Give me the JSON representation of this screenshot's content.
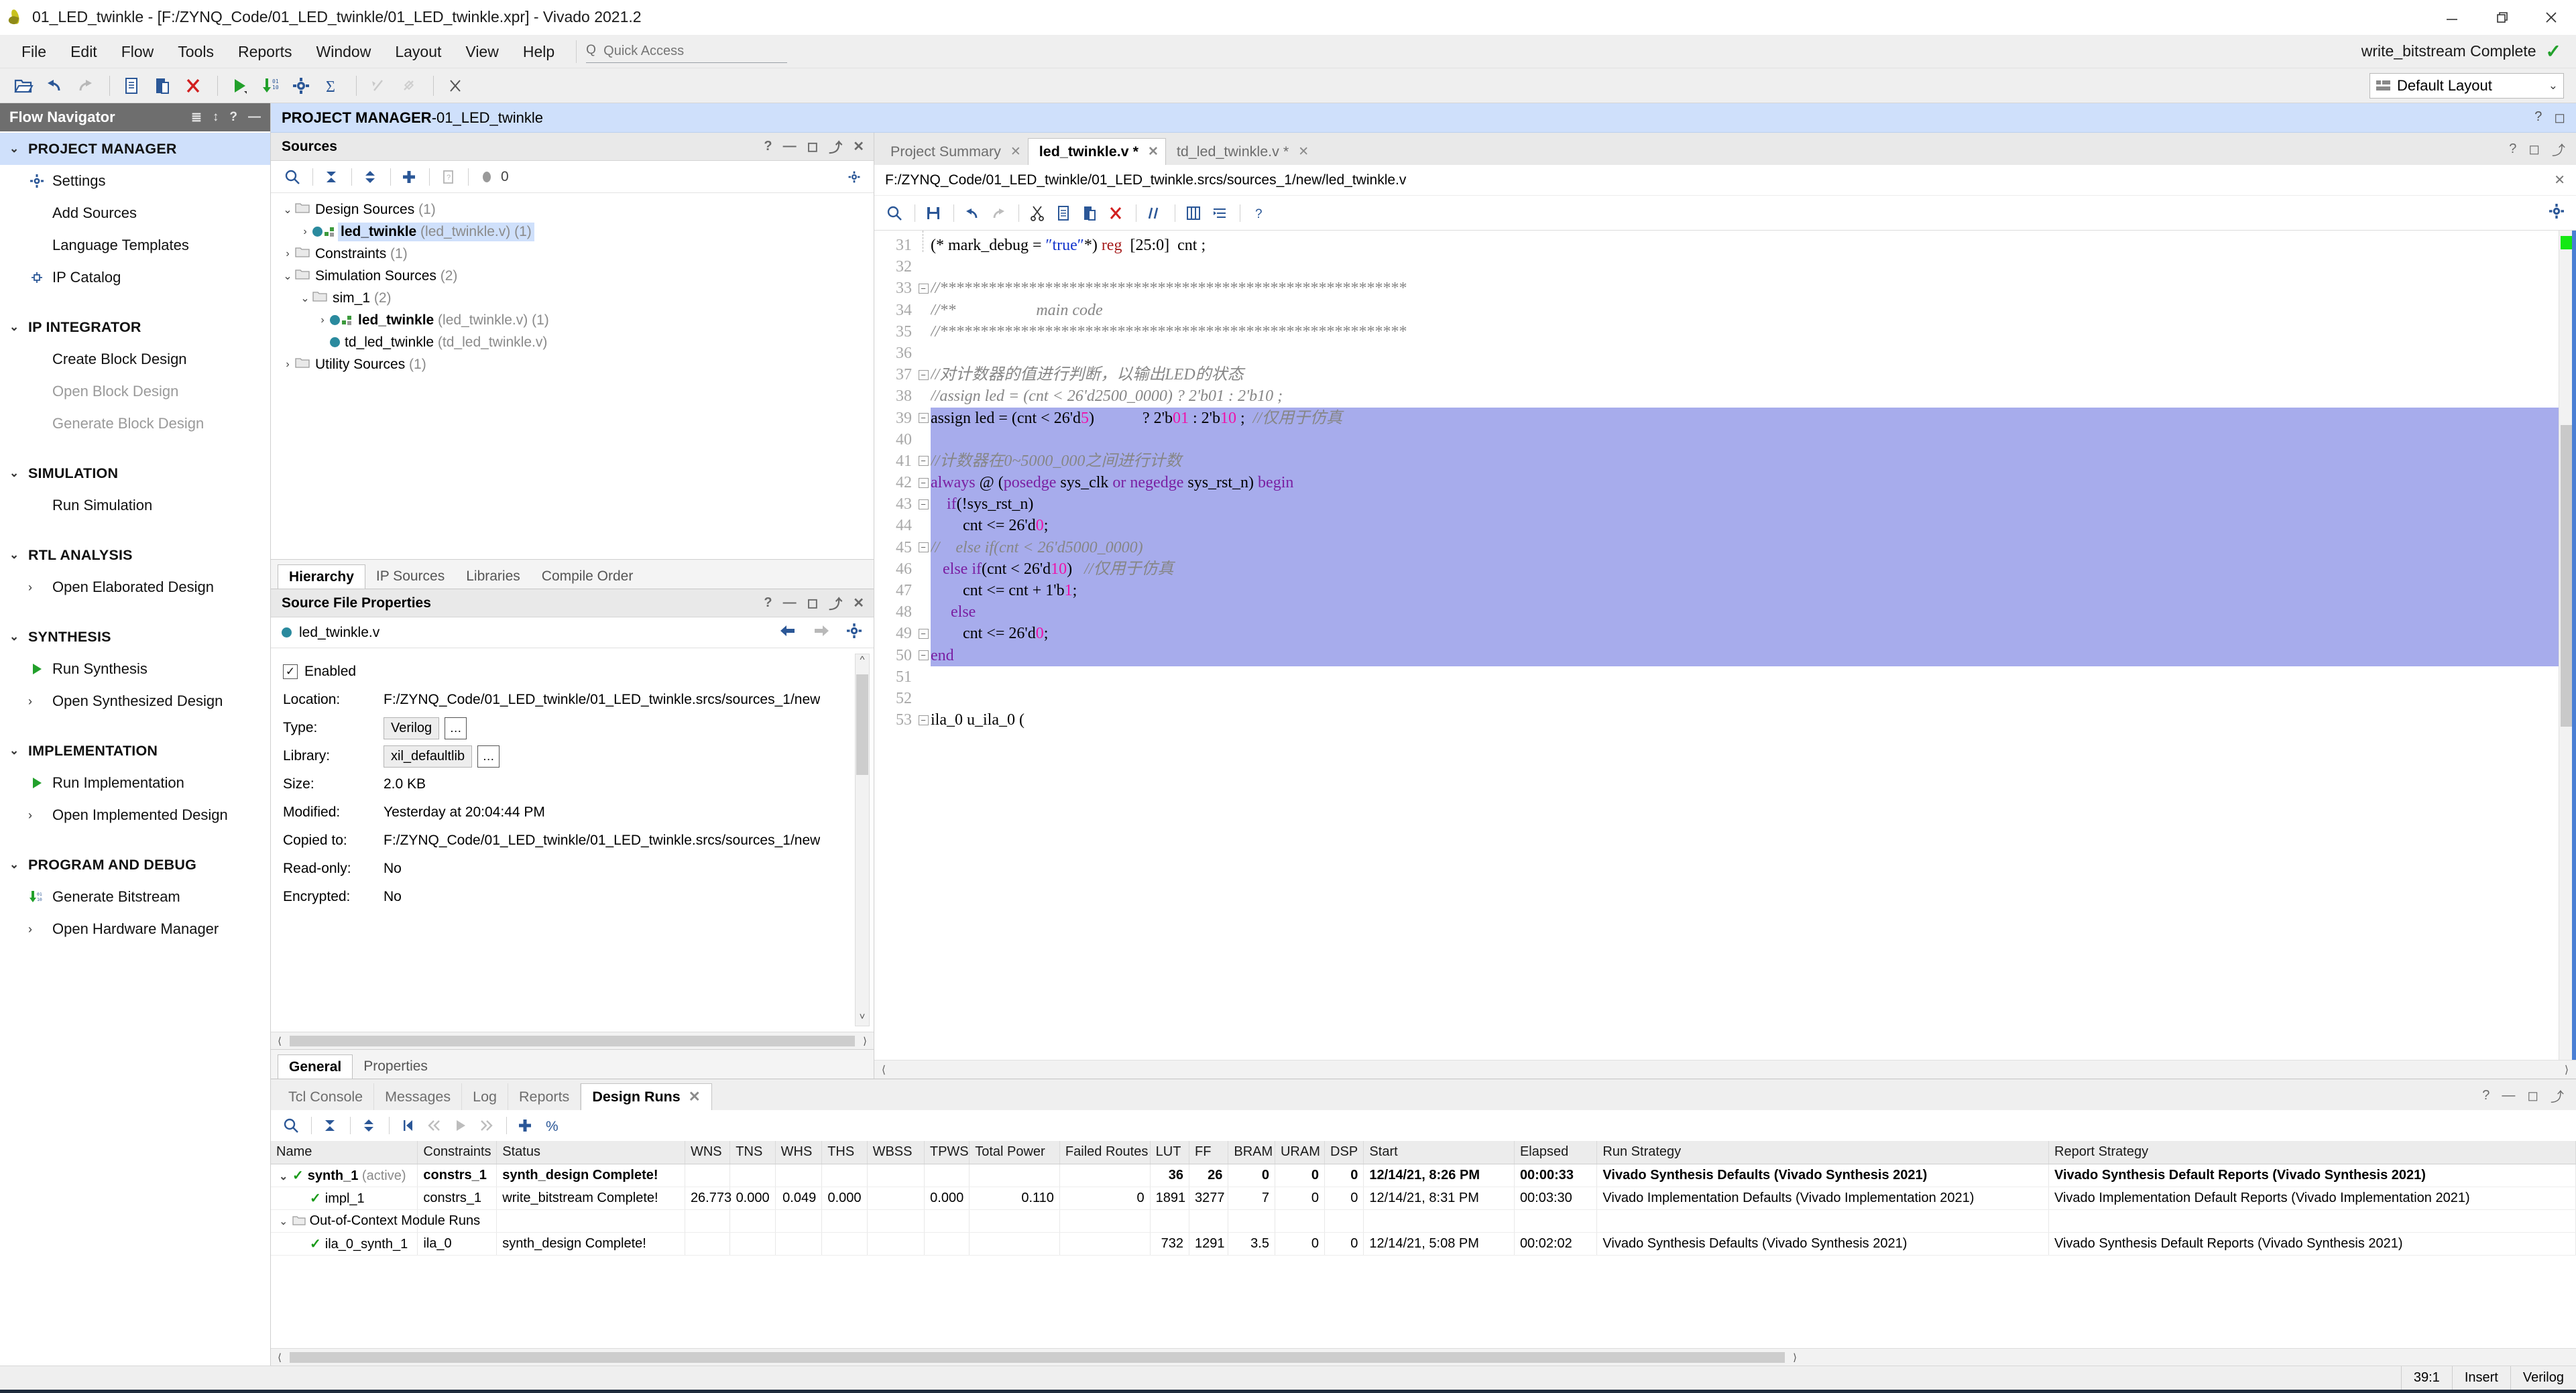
{
  "window": {
    "title": "01_LED_twinkle - [F:/ZYNQ_Code/01_LED_twinkle/01_LED_twinkle.xpr] - Vivado 2021.2",
    "minimize": "—",
    "restore": "❐",
    "close": "✕"
  },
  "menu": {
    "items": [
      "File",
      "Edit",
      "Flow",
      "Tools",
      "Reports",
      "Window",
      "Layout",
      "View",
      "Help"
    ],
    "quick_access_placeholder": "Quick Access",
    "quick_access_icon": "search-icon",
    "status_text": "write_bitstream Complete",
    "status_check": "✓"
  },
  "toolbar": {
    "layout_label": "Default Layout",
    "layout_chevron": "⌄",
    "icons": [
      "open-project-icon",
      "undo-icon",
      "redo-icon",
      "copy-icon",
      "paste-icon",
      "delete-icon",
      "run-icon",
      "generate-bitstream-icon",
      "settings-icon",
      "sum-icon",
      "disabled-icon-1",
      "disabled-icon-2",
      "disabled-icon-3"
    ]
  },
  "flow_navigator": {
    "title": "Flow Navigator",
    "header_icons": [
      "collapse-all-icon",
      "expand-collapse-icon",
      "help-icon",
      "minimize-icon"
    ],
    "sections": [
      {
        "label": "PROJECT MANAGER",
        "active": true,
        "items": [
          {
            "label": "Settings",
            "icon": "gear-icon",
            "dim": false
          },
          {
            "label": "Add Sources",
            "icon": "",
            "dim": false
          },
          {
            "label": "Language Templates",
            "icon": "",
            "dim": false
          },
          {
            "label": "IP Catalog",
            "icon": "ip-catalog-icon",
            "dim": false
          }
        ]
      },
      {
        "label": "IP INTEGRATOR",
        "active": false,
        "items": [
          {
            "label": "Create Block Design",
            "icon": "",
            "dim": false
          },
          {
            "label": "Open Block Design",
            "icon": "",
            "dim": true
          },
          {
            "label": "Generate Block Design",
            "icon": "",
            "dim": true
          }
        ]
      },
      {
        "label": "SIMULATION",
        "active": false,
        "items": [
          {
            "label": "Run Simulation",
            "icon": "",
            "dim": false
          }
        ]
      },
      {
        "label": "RTL ANALYSIS",
        "active": false,
        "items": [
          {
            "label": "Open Elaborated Design",
            "icon": "chevron-right-icon",
            "dim": false
          }
        ]
      },
      {
        "label": "SYNTHESIS",
        "active": false,
        "items": [
          {
            "label": "Run Synthesis",
            "icon": "play-icon",
            "dim": false
          },
          {
            "label": "Open Synthesized Design",
            "icon": "chevron-right-icon",
            "dim": false
          }
        ]
      },
      {
        "label": "IMPLEMENTATION",
        "active": false,
        "items": [
          {
            "label": "Run Implementation",
            "icon": "play-icon",
            "dim": false
          },
          {
            "label": "Open Implemented Design",
            "icon": "chevron-right-icon",
            "dim": false
          }
        ]
      },
      {
        "label": "PROGRAM AND DEBUG",
        "active": false,
        "items": [
          {
            "label": "Generate Bitstream",
            "icon": "generate-bitstream-icon",
            "dim": false
          },
          {
            "label": "Open Hardware Manager",
            "icon": "chevron-right-icon",
            "dim": false
          }
        ]
      }
    ]
  },
  "project_bar": {
    "prefix": "PROJECT MANAGER",
    "separator": " - ",
    "name": "01_LED_twinkle",
    "icons": [
      "help-icon",
      "maximize-icon"
    ]
  },
  "sources": {
    "title": "Sources",
    "header_icons": [
      "help-icon",
      "minimize-icon",
      "maximize-icon",
      "float-icon",
      "close-icon"
    ],
    "toolbar_icons": [
      "search-icon",
      "collapse-all-icon",
      "expand-all-icon",
      "add-sources-icon",
      "report-icon"
    ],
    "badge_count": "0",
    "settings_icon": "gear-icon",
    "tree": [
      {
        "indent": 0,
        "twisty": "⌄",
        "folder": true,
        "label": "Design Sources",
        "count": "(1)",
        "bold": false,
        "selected": false,
        "dot": false,
        "mod": false
      },
      {
        "indent": 1,
        "twisty": "›",
        "folder": false,
        "label": "led_twinkle",
        "file": "(led_twinkle.v)",
        "count": "(1)",
        "bold": true,
        "selected": true,
        "dot": true,
        "mod": true
      },
      {
        "indent": 0,
        "twisty": "›",
        "folder": true,
        "label": "Constraints",
        "count": "(1)",
        "bold": false,
        "selected": false,
        "dot": false,
        "mod": false
      },
      {
        "indent": 0,
        "twisty": "⌄",
        "folder": true,
        "label": "Simulation Sources",
        "count": "(2)",
        "bold": false,
        "selected": false,
        "dot": false,
        "mod": false
      },
      {
        "indent": 1,
        "twisty": "⌄",
        "folder": true,
        "label": "sim_1",
        "count": "(2)",
        "bold": false,
        "selected": false,
        "dot": false,
        "mod": false
      },
      {
        "indent": 2,
        "twisty": "›",
        "folder": false,
        "label": "led_twinkle",
        "file": "(led_twinkle.v)",
        "count": "(1)",
        "bold": true,
        "selected": false,
        "dot": true,
        "mod": true
      },
      {
        "indent": 2,
        "twisty": "",
        "folder": false,
        "label": "td_led_twinkle",
        "file": "(td_led_twinkle.v)",
        "count": "",
        "bold": false,
        "selected": false,
        "dot": true,
        "mod": false
      },
      {
        "indent": 0,
        "twisty": "›",
        "folder": true,
        "label": "Utility Sources",
        "count": "(1)",
        "bold": false,
        "selected": false,
        "dot": false,
        "mod": false
      }
    ],
    "tabs": [
      {
        "label": "Hierarchy",
        "active": true
      },
      {
        "label": "IP Sources",
        "active": false
      },
      {
        "label": "Libraries",
        "active": false
      },
      {
        "label": "Compile Order",
        "active": false
      }
    ]
  },
  "source_properties": {
    "title": "Source File Properties",
    "header_icons": [
      "help-icon",
      "minimize-icon",
      "maximize-icon",
      "float-icon",
      "close-icon"
    ],
    "file_name": "led_twinkle.v",
    "nav_icons": [
      "back-arrow-icon",
      "forward-arrow-icon",
      "gear-icon"
    ],
    "enabled_label": "Enabled",
    "enabled_checked": "✓",
    "rows": [
      {
        "label": "Location:",
        "value": "F:/ZYNQ_Code/01_LED_twinkle/01_LED_twinkle.srcs/sources_1/new",
        "kind": "text"
      },
      {
        "label": "Type:",
        "value": "Verilog",
        "kind": "field"
      },
      {
        "label": "Library:",
        "value": "xil_defaultlib",
        "kind": "field"
      },
      {
        "label": "Size:",
        "value": "2.0 KB",
        "kind": "text"
      },
      {
        "label": "Modified:",
        "value": "Yesterday at 20:04:44 PM",
        "kind": "text"
      },
      {
        "label": "Copied to:",
        "value": "F:/ZYNQ_Code/01_LED_twinkle/01_LED_twinkle.srcs/sources_1/new",
        "kind": "text"
      },
      {
        "label": "Read-only:",
        "value": "No",
        "kind": "text"
      },
      {
        "label": "Encrypted:",
        "value": "No",
        "kind": "text"
      }
    ],
    "ellipsis": "…",
    "tabs": [
      {
        "label": "General",
        "active": true
      },
      {
        "label": "Properties",
        "active": false
      }
    ]
  },
  "editor": {
    "tabs": [
      {
        "label": "Project Summary",
        "active": false,
        "close": "✕"
      },
      {
        "label": "led_twinkle.v *",
        "active": true,
        "close": "✕"
      },
      {
        "label": "td_led_twinkle.v *",
        "active": false,
        "close": "✕"
      }
    ],
    "header_icons": [
      "help-icon",
      "maximize-icon",
      "float-icon"
    ],
    "path": "F:/ZYNQ_Code/01_LED_twinkle/01_LED_twinkle.srcs/sources_1/new/led_twinkle.v",
    "path_close": "✕",
    "toolbar_icons": [
      "search-icon",
      "save-icon",
      "undo-icon",
      "redo-icon",
      "cut-icon",
      "copy-icon",
      "paste-icon",
      "delete-icon",
      "comment-icon",
      "indent-icon",
      "outdent-icon",
      "help-icon"
    ],
    "settings_icon": "gear-icon",
    "first_line": 31,
    "lines": [
      {
        "n": 31,
        "fold": "",
        "hl": false,
        "tokens": [
          {
            "t": "(* mark_debug = ",
            "c": ""
          },
          {
            "t": "″true″",
            "c": "s"
          },
          {
            "t": "*) ",
            "c": ""
          },
          {
            "t": "reg",
            "c": "kr"
          },
          {
            "t": "  [25:0]  cnt ;",
            "c": ""
          }
        ]
      },
      {
        "n": 32,
        "fold": "",
        "hl": false,
        "tokens": []
      },
      {
        "n": 33,
        "fold": "minus",
        "hl": false,
        "tokens": [
          {
            "t": "//**********************************************************",
            "c": "c"
          }
        ]
      },
      {
        "n": 34,
        "fold": "",
        "hl": false,
        "tokens": [
          {
            "t": "//**                    main code",
            "c": "c"
          }
        ]
      },
      {
        "n": 35,
        "fold": "",
        "hl": false,
        "tokens": [
          {
            "t": "//**********************************************************",
            "c": "c"
          }
        ]
      },
      {
        "n": 36,
        "fold": "",
        "hl": false,
        "tokens": []
      },
      {
        "n": 37,
        "fold": "minus",
        "hl": false,
        "tokens": [
          {
            "t": "//对计数器的值进行判断，以输出LED的状态",
            "c": "c"
          }
        ]
      },
      {
        "n": 38,
        "fold": "",
        "hl": false,
        "tokens": [
          {
            "t": "//assign led = (cnt < 26'd2500_0000) ? 2'b01 : 2'b10 ;",
            "c": "c"
          }
        ]
      },
      {
        "n": 39,
        "fold": "minus",
        "hl": true,
        "tokens": [
          {
            "t": "assign led = (cnt < 26'd",
            "c": ""
          },
          {
            "t": "5",
            "c": "n"
          },
          {
            "t": ")            ? 2'b",
            "c": ""
          },
          {
            "t": "01",
            "c": "n"
          },
          {
            "t": " : 2'b",
            "c": ""
          },
          {
            "t": "10",
            "c": "n"
          },
          {
            "t": " ;  ",
            "c": ""
          },
          {
            "t": "//仅用于仿真",
            "c": "c"
          }
        ]
      },
      {
        "n": 40,
        "fold": "",
        "hl": true,
        "tokens": []
      },
      {
        "n": 41,
        "fold": "minus",
        "hl": true,
        "tokens": [
          {
            "t": "//计数器在0~5000_000之间进行计数",
            "c": "c"
          }
        ]
      },
      {
        "n": 42,
        "fold": "minus",
        "hl": true,
        "tokens": [
          {
            "t": "always",
            "c": "k"
          },
          {
            "t": " @ (",
            "c": ""
          },
          {
            "t": "posedge",
            "c": "k"
          },
          {
            "t": " sys_clk ",
            "c": ""
          },
          {
            "t": "or",
            "c": "k"
          },
          {
            "t": " ",
            "c": ""
          },
          {
            "t": "negedge",
            "c": "k"
          },
          {
            "t": " sys_rst_n) ",
            "c": ""
          },
          {
            "t": "begin",
            "c": "k"
          }
        ]
      },
      {
        "n": 43,
        "fold": "minus",
        "hl": true,
        "tokens": [
          {
            "t": "    ",
            "c": ""
          },
          {
            "t": "if",
            "c": "k"
          },
          {
            "t": "(!sys_rst_n)",
            "c": ""
          }
        ]
      },
      {
        "n": 44,
        "fold": "",
        "hl": true,
        "tokens": [
          {
            "t": "        cnt <= 26'd",
            "c": ""
          },
          {
            "t": "0",
            "c": "n"
          },
          {
            "t": ";",
            "c": ""
          }
        ]
      },
      {
        "n": 45,
        "fold": "minus",
        "hl": true,
        "tokens": [
          {
            "t": "//    else if(cnt < 26'd5000_0000)",
            "c": "c"
          }
        ]
      },
      {
        "n": 46,
        "fold": "",
        "hl": true,
        "tokens": [
          {
            "t": "   ",
            "c": ""
          },
          {
            "t": "else",
            "c": "k"
          },
          {
            "t": " ",
            "c": ""
          },
          {
            "t": "if",
            "c": "k"
          },
          {
            "t": "(cnt < 26'd",
            "c": ""
          },
          {
            "t": "10",
            "c": "n"
          },
          {
            "t": ")   ",
            "c": ""
          },
          {
            "t": "//仅用于仿真",
            "c": "c"
          }
        ]
      },
      {
        "n": 47,
        "fold": "",
        "hl": true,
        "tokens": [
          {
            "t": "        cnt <= cnt + 1'b",
            "c": ""
          },
          {
            "t": "1",
            "c": "n"
          },
          {
            "t": ";",
            "c": ""
          }
        ]
      },
      {
        "n": 48,
        "fold": "",
        "hl": true,
        "tokens": [
          {
            "t": "     ",
            "c": ""
          },
          {
            "t": "else",
            "c": "k"
          }
        ]
      },
      {
        "n": 49,
        "fold": "minus",
        "hl": true,
        "tokens": [
          {
            "t": "        cnt <= 26'd",
            "c": ""
          },
          {
            "t": "0",
            "c": "n"
          },
          {
            "t": ";",
            "c": ""
          }
        ]
      },
      {
        "n": 50,
        "fold": "minus",
        "hl": true,
        "tokens": [
          {
            "t": "end",
            "c": "k"
          }
        ]
      },
      {
        "n": 51,
        "fold": "",
        "hl": false,
        "tokens": []
      },
      {
        "n": 52,
        "fold": "",
        "hl": false,
        "tokens": []
      },
      {
        "n": 53,
        "fold": "minus",
        "hl": false,
        "tokens": [
          {
            "t": "ila_0 u_ila_0 (",
            "c": ""
          }
        ]
      }
    ]
  },
  "bottom_dock": {
    "tabs": [
      {
        "label": "Tcl Console",
        "active": false
      },
      {
        "label": "Messages",
        "active": false
      },
      {
        "label": "Log",
        "active": false
      },
      {
        "label": "Reports",
        "active": false
      },
      {
        "label": "Design Runs",
        "active": true,
        "close": "✕"
      }
    ],
    "header_icons": [
      "help-icon",
      "minimize-icon",
      "maximize-icon",
      "float-icon"
    ],
    "toolbar_icons": [
      "search-icon",
      "collapse-all-icon",
      "expand-all-icon",
      "first-icon",
      "prev-all-icon",
      "play-icon",
      "next-all-icon",
      "add-icon",
      "percent-icon"
    ],
    "columns": [
      "Name",
      "Constraints",
      "Status",
      "WNS",
      "TNS",
      "WHS",
      "THS",
      "WBSS",
      "TPWS",
      "Total Power",
      "Failed Routes",
      "LUT",
      "FF",
      "BRAM",
      "URAM",
      "DSP",
      "Start",
      "Elapsed",
      "Run Strategy",
      "Report Strategy"
    ],
    "rows": [
      {
        "indent": 0,
        "twisty": "⌄",
        "tick": "✓",
        "bold": true,
        "name": "synth_1",
        "name_suffix": "(active)",
        "folder_icon": false,
        "cells": [
          "constrs_1",
          "synth_design Complete!",
          "",
          "",
          "",
          "",
          "",
          "",
          "",
          "",
          "36",
          "26",
          "0",
          "0",
          "0",
          "12/14/21, 8:26 PM",
          "00:00:33",
          "Vivado Synthesis Defaults (Vivado Synthesis 2021)",
          "Vivado Synthesis Default Reports (Vivado Synthesis 2021)"
        ]
      },
      {
        "indent": 1,
        "twisty": "",
        "tick": "✓",
        "bold": false,
        "name": "impl_1",
        "name_suffix": "",
        "folder_icon": false,
        "cells": [
          "constrs_1",
          "write_bitstream Complete!",
          "26.773",
          "0.000",
          "0.049",
          "0.000",
          "",
          "0.000",
          "0.110",
          "0",
          "1891",
          "3277",
          "7",
          "0",
          "0",
          "12/14/21, 8:31 PM",
          "00:03:30",
          "Vivado Implementation Defaults (Vivado Implementation 2021)",
          "Vivado Implementation Default Reports (Vivado Implementation 2021)"
        ]
      },
      {
        "indent": 0,
        "twisty": "⌄",
        "tick": "",
        "bold": false,
        "name": "Out-of-Context Module Runs",
        "name_suffix": "",
        "folder_icon": true,
        "cells": [
          "",
          "",
          "",
          "",
          "",
          "",
          "",
          "",
          "",
          "",
          "",
          "",
          "",
          "",
          "",
          "",
          "",
          "",
          ""
        ]
      },
      {
        "indent": 1,
        "twisty": "",
        "tick": "✓",
        "bold": false,
        "name": "ila_0_synth_1",
        "name_suffix": "",
        "folder_icon": false,
        "cells": [
          "ila_0",
          "synth_design Complete!",
          "",
          "",
          "",
          "",
          "",
          "",
          "",
          "",
          "732",
          "1291",
          "3.5",
          "0",
          "0",
          "12/14/21, 5:08 PM",
          "00:02:02",
          "Vivado Synthesis Defaults (Vivado Synthesis 2021)",
          "Vivado Synthesis Default Reports (Vivado Synthesis 2021)"
        ]
      }
    ]
  },
  "status_bar": {
    "cursor": "39:1",
    "mode": "Insert",
    "language": "Verilog"
  }
}
